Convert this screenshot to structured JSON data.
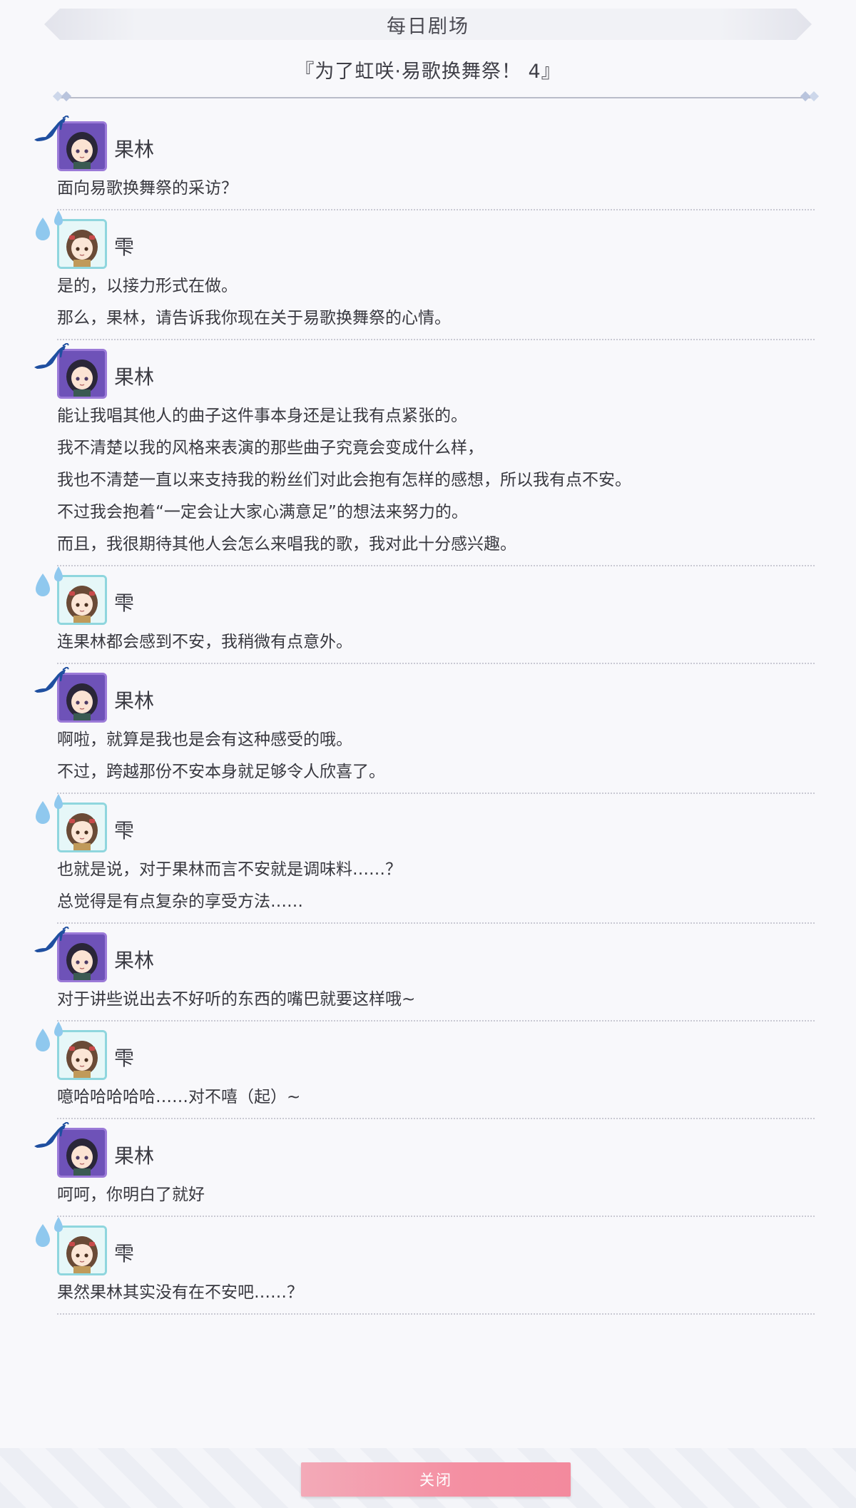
{
  "header": {
    "title": "每日剧场"
  },
  "story": {
    "title": "『为了虹咲·易歌换舞祭！ 4』"
  },
  "dialogue": [
    {
      "speaker": "果林",
      "character": "karin",
      "icon": "heel-icon",
      "lines": [
        "面向易歌换舞祭的采访？"
      ]
    },
    {
      "speaker": "雫",
      "character": "shizuku",
      "icon": "drops-icon",
      "lines": [
        "是的，以接力形式在做。",
        "那么，果林，请告诉我你现在关于易歌换舞祭的心情。"
      ]
    },
    {
      "speaker": "果林",
      "character": "karin",
      "icon": "heel-icon",
      "lines": [
        "能让我唱其他人的曲子这件事本身还是让我有点紧张的。",
        "我不清楚以我的风格来表演的那些曲子究竟会变成什么样，",
        "我也不清楚一直以来支持我的粉丝们对此会抱有怎样的感想，所以我有点不安。",
        "不过我会抱着“一定会让大家心满意足”的想法来努力的。",
        "而且，我很期待其他人会怎么来唱我的歌，我对此十分感兴趣。"
      ]
    },
    {
      "speaker": "雫",
      "character": "shizuku",
      "icon": "drops-icon",
      "lines": [
        "连果林都会感到不安，我稍微有点意外。"
      ]
    },
    {
      "speaker": "果林",
      "character": "karin",
      "icon": "heel-icon",
      "lines": [
        "啊啦，就算是我也是会有这种感受的哦。",
        "不过，跨越那份不安本身就足够令人欣喜了。"
      ]
    },
    {
      "speaker": "雫",
      "character": "shizuku",
      "icon": "drops-icon",
      "lines": [
        "也就是说，对于果林而言不安就是调味料……？",
        "总觉得是有点复杂的享受方法……"
      ]
    },
    {
      "speaker": "果林",
      "character": "karin",
      "icon": "heel-icon",
      "lines": [
        "对于讲些说出去不好听的东西的嘴巴就要这样哦~"
      ]
    },
    {
      "speaker": "雫",
      "character": "shizuku",
      "icon": "drops-icon",
      "lines": [
        "噫哈哈哈哈哈……对不嘻（起）~"
      ]
    },
    {
      "speaker": "果林",
      "character": "karin",
      "icon": "heel-icon",
      "lines": [
        "呵呵，你明白了就好"
      ]
    },
    {
      "speaker": "雫",
      "character": "shizuku",
      "icon": "drops-icon",
      "lines": [
        "果然果林其实没有在不安吧……？"
      ]
    }
  ],
  "footer": {
    "close_label": "关闭"
  },
  "colors": {
    "close_button": "#f48fa2",
    "karin_frame": "#9b7ad8",
    "shizuku_frame": "#8fd6de",
    "heel_icon": "#1f4fa0",
    "drops_icon": "#8fc8ee"
  }
}
